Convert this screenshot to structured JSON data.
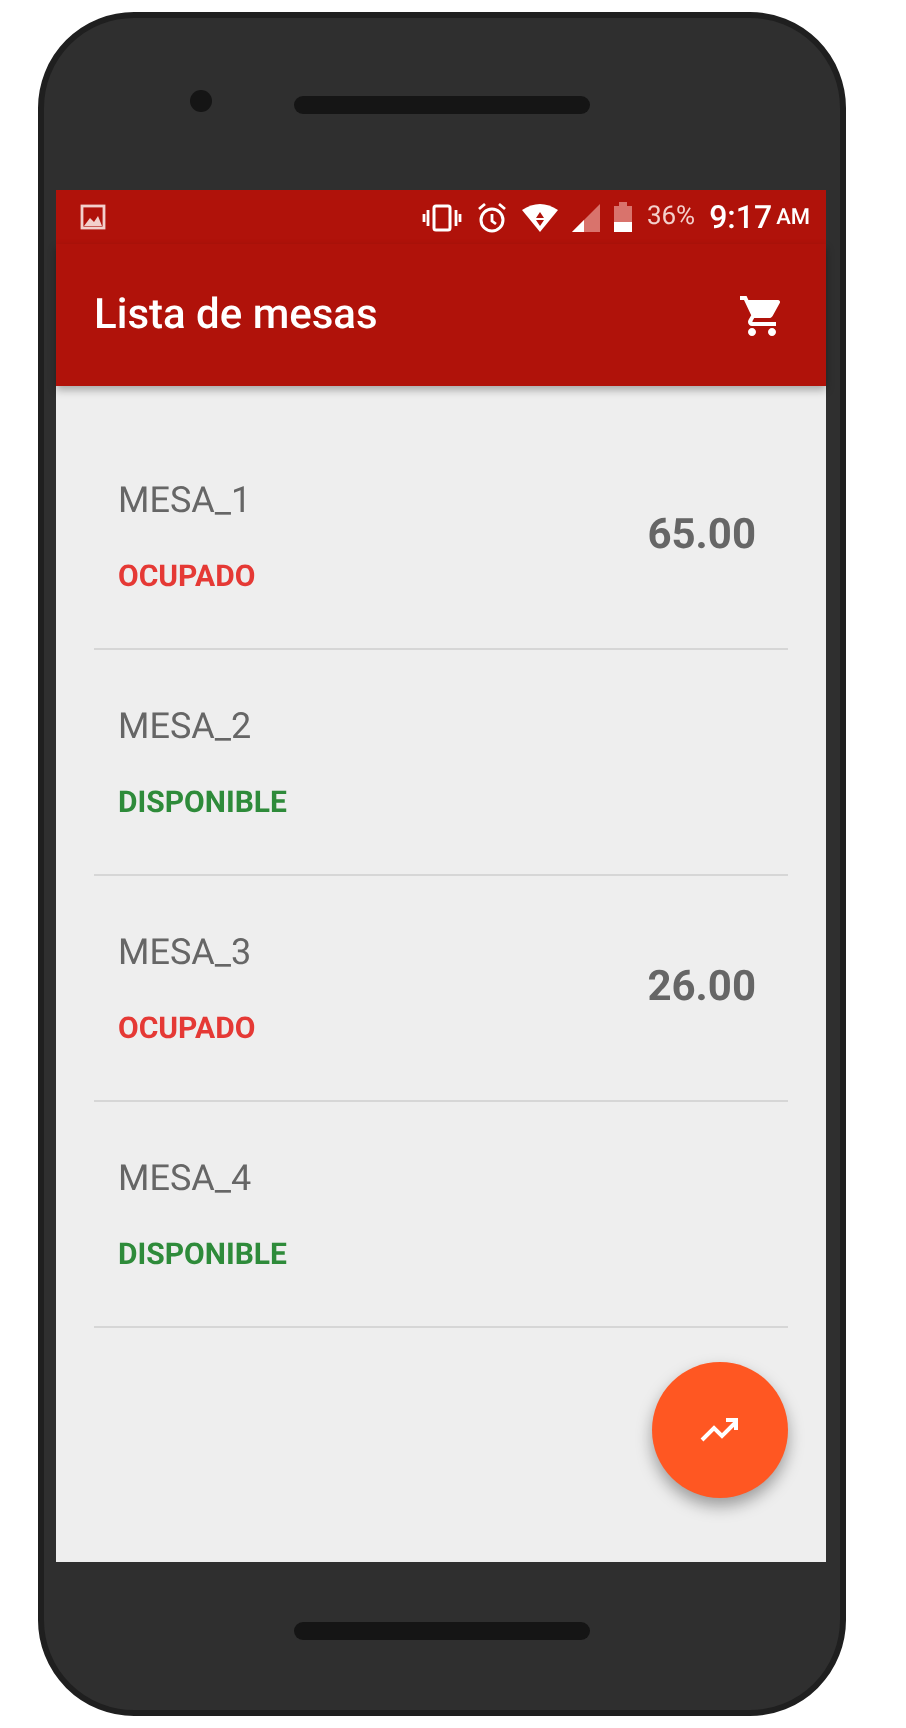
{
  "status_bar": {
    "battery": "36%",
    "time": "9:17",
    "meridiem": "AM"
  },
  "app_bar": {
    "title": "Lista de mesas"
  },
  "tables": [
    {
      "name": "MESA_1",
      "status": "OCUPADO",
      "kind": "occupied",
      "amount": "65.00"
    },
    {
      "name": "MESA_2",
      "status": "DISPONIBLE",
      "kind": "available"
    },
    {
      "name": "MESA_3",
      "status": "OCUPADO",
      "kind": "occupied",
      "amount": "26.00"
    },
    {
      "name": "MESA_4",
      "status": "DISPONIBLE",
      "kind": "available"
    }
  ]
}
